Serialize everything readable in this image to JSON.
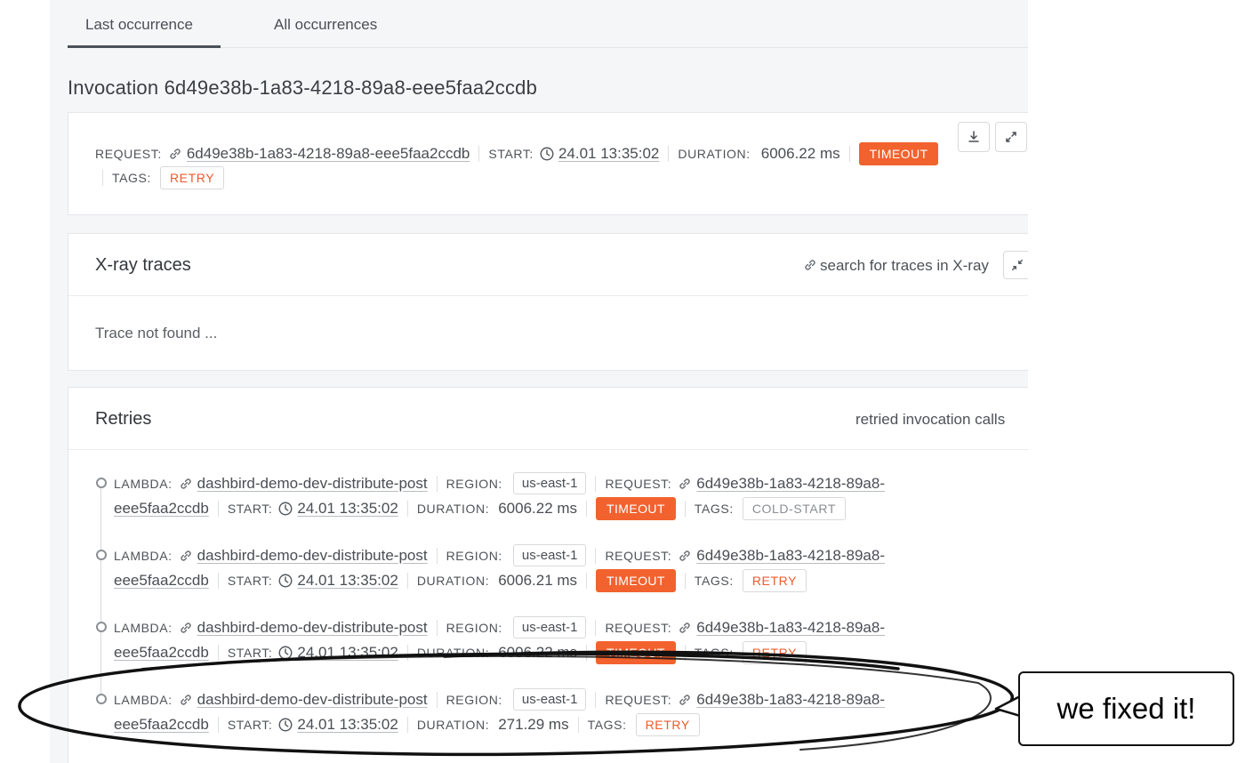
{
  "tabs": [
    {
      "label": "Last occurrence"
    },
    {
      "label": "All occurrences"
    }
  ],
  "invocation": {
    "title": "Invocation 6d49e38b-1a83-4218-89a8-eee5faa2ccdb",
    "request_label": "REQUEST:",
    "request_id": "6d49e38b-1a83-4218-89a8-eee5faa2ccdb",
    "start_label": "START:",
    "start": "24.01 13:35:02",
    "duration_label": "DURATION:",
    "duration": "6006.22 ms",
    "status": "TIMEOUT",
    "tags_label": "TAGS:",
    "tags": [
      "RETRY"
    ]
  },
  "xray": {
    "title": "X-ray traces",
    "search_link": "search for traces in X-ray",
    "empty": "Trace not found ..."
  },
  "retries": {
    "title": "Retries",
    "subtitle": "retried invocation calls",
    "items": [
      {
        "lambda_label": "LAMBDA:",
        "lambda": "dashbird-demo-dev-distribute-post",
        "region_label": "REGION:",
        "region": "us-east-1",
        "request_label": "REQUEST:",
        "request_1": "6d49e38b-1a83-4218-89a8-",
        "request_2": "eee5faa2ccdb",
        "start_label": "START:",
        "start": "24.01 13:35:02",
        "duration_label": "DURATION:",
        "duration": "6006.22 ms",
        "status": "TIMEOUT",
        "tags_label": "TAGS:",
        "tag": "COLD-START"
      },
      {
        "lambda_label": "LAMBDA:",
        "lambda": "dashbird-demo-dev-distribute-post",
        "region_label": "REGION:",
        "region": "us-east-1",
        "request_label": "REQUEST:",
        "request_1": "6d49e38b-1a83-4218-89a8-",
        "request_2": "eee5faa2ccdb",
        "start_label": "START:",
        "start": "24.01 13:35:02",
        "duration_label": "DURATION:",
        "duration": "6006.21 ms",
        "status": "TIMEOUT",
        "tags_label": "TAGS:",
        "tag": "RETRY"
      },
      {
        "lambda_label": "LAMBDA:",
        "lambda": "dashbird-demo-dev-distribute-post",
        "region_label": "REGION:",
        "region": "us-east-1",
        "request_label": "REQUEST:",
        "request_1": "6d49e38b-1a83-4218-89a8-",
        "request_2": "eee5faa2ccdb",
        "start_label": "START:",
        "start": "24.01 13:35:02",
        "duration_label": "DURATION:",
        "duration": "6006.22 ms",
        "status": "TIMEOUT",
        "tags_label": "TAGS:",
        "tag": "RETRY"
      },
      {
        "lambda_label": "LAMBDA:",
        "lambda": "dashbird-demo-dev-distribute-post",
        "region_label": "REGION:",
        "region": "us-east-1",
        "request_label": "REQUEST:",
        "request_1": "6d49e38b-1a83-4218-89a8-",
        "request_2": "eee5faa2ccdb",
        "start_label": "START:",
        "start": "24.01 13:35:02",
        "duration_label": "DURATION:",
        "duration": "271.29 ms",
        "status": "",
        "tags_label": "TAGS:",
        "tag": "RETRY"
      }
    ]
  },
  "annotation": {
    "bubble_text": "we fixed it!"
  },
  "colors": {
    "accent_orange": "#f2622e",
    "tag_red": "#ef5a2b"
  },
  "icons": [
    "link-icon",
    "clock-icon",
    "download-icon",
    "expand-icon"
  ]
}
